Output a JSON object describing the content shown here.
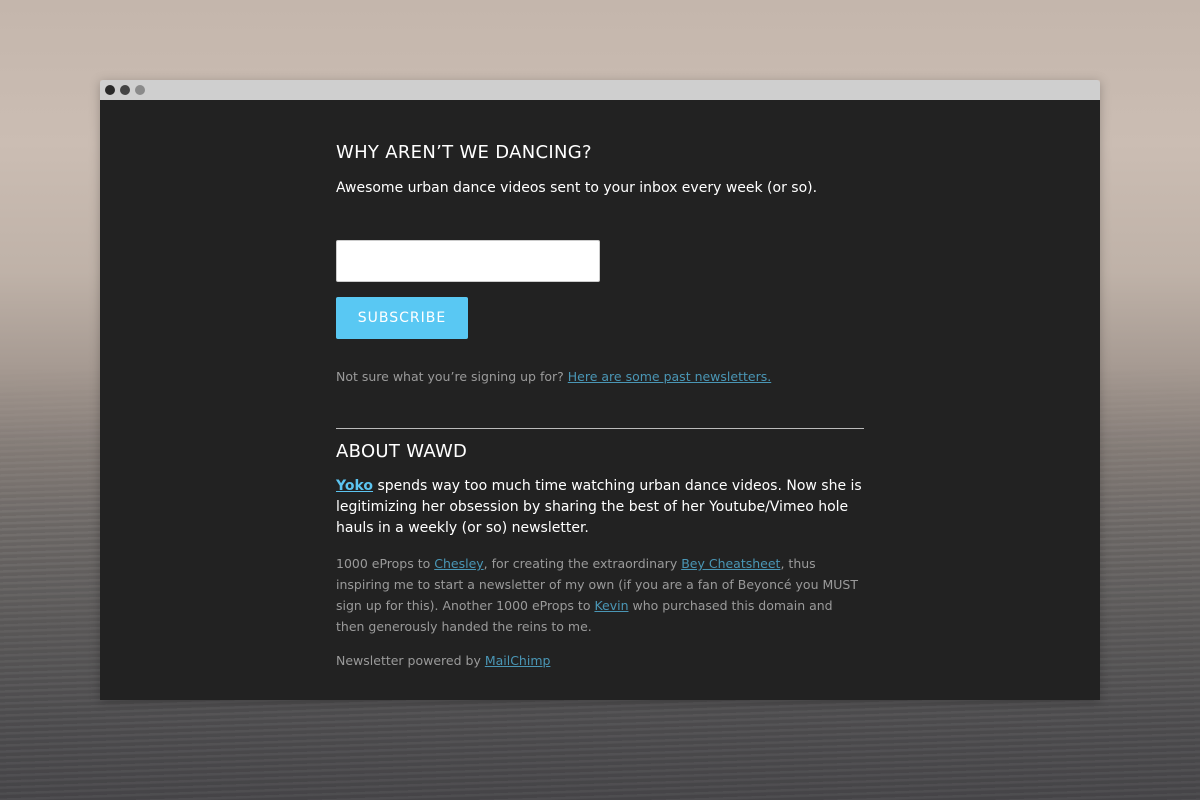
{
  "signup": {
    "heading": "WHY AREN’T WE DANCING?",
    "tagline": "Awesome urban dance videos sent to your inbox every week (or so).",
    "email_value": "",
    "subscribe_label": "SUBSCRIBE",
    "unsure_text": "Not sure what you’re signing up for?",
    "past_newsletters_link": "Here are some past newsletters."
  },
  "about": {
    "heading": "ABOUT WAWD",
    "yoko_link": "Yoko",
    "intro_text": " spends way too much time watching urban dance videos. Now she is legitimizing her obsession by sharing the best of her Youtube/Vimeo hole hauls in a weekly (or so) newsletter.",
    "credits_part1": "1000 eProps to ",
    "chesley_link": "Chesley",
    "credits_part2": ", for creating the extraordinary ",
    "bey_link": "Bey Cheatsheet",
    "credits_part3": ", thus inspiring me to start a newsletter of my own (if you are a fan of Beyoncé you MUST sign up for this). Another 1000 eProps to ",
    "kevin_link": "Kevin",
    "credits_part4": " who purchased this domain and then generously handed the reins to me.",
    "powered_text": "Newsletter powered by ",
    "mailchimp_link": "MailChimp"
  },
  "colors": {
    "page_background": "#222222",
    "accent_button": "#59c8f3",
    "link": "#4a96b5",
    "bright_link": "#5cc4f0"
  }
}
